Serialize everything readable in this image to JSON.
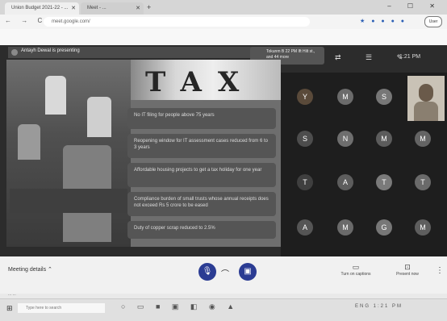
{
  "browser": {
    "tabs": [
      {
        "label": "Union Budget 2021-22 - ..."
      },
      {
        "label": "Meet - ..."
      }
    ],
    "new_tab_symbol": "+",
    "window_controls": "– ☐ ✕",
    "nav_symbols": "← → C",
    "url": "meet.google.com/",
    "extension_icons": "★ ● ● ● ●",
    "profile_label": "User"
  },
  "meet": {
    "presenter_label": "Antayh Dewal is presenting",
    "notice_text": "Tokunm B 22 PM Ift Hilt st., and 44 more",
    "top_icons": "⇄ ☰ ✎",
    "time": "1:21 PM",
    "slide": {
      "banner_text": "TAX",
      "bullets": [
        "No IT filing for people above 75 years",
        "Reopening window for IT assessment cases reduced from 6 to 3 years",
        "Affordable housing projects to get a tax holiday for one year",
        "Compliance burden of small trusts whose annual receipts does not exceed Rs 5 crore to be eased",
        "Duty of copper scrap reduced to 2.5%"
      ]
    },
    "participants": [
      "Y",
      "M",
      "S",
      "N",
      "M",
      "M",
      "T",
      "A",
      "T",
      "T",
      "A",
      "M",
      "G",
      "M",
      "M"
    ]
  },
  "controls": {
    "meeting_details": "Meeting details",
    "mic_icon": "mic-icon",
    "end_icon": "present-icon",
    "right_buttons": [
      {
        "label": "Turn on captions",
        "icon": "captions-icon"
      },
      {
        "label": "Present now",
        "icon": "present-now-icon"
      }
    ],
    "more_symbol": "⋮",
    "status_line": "... ..."
  },
  "taskbar": {
    "search_placeholder": "Type here to search",
    "tray_text": "ENG 1:21 PM"
  },
  "colors": {
    "accent": "#2b3c93",
    "meet_bg": "#2c2c2c"
  }
}
